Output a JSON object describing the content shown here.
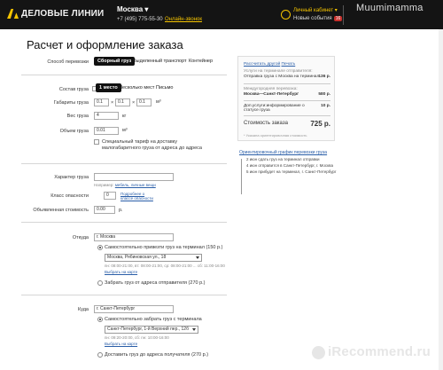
{
  "header": {
    "logo_text": "ДЕЛОВЫЕ ЛИНИИ",
    "city": "Москва ▾",
    "phone": "+7 (495) 775-55-30",
    "callback": "Онлайн-звонок",
    "cabinet": "Личный кабинет ▾",
    "events": "Новые события",
    "events_count": "16",
    "watermark": "Muumimamma"
  },
  "page": {
    "title": "Расчет и оформление заказа"
  },
  "transport": {
    "label": "Способ перевозки",
    "tabs": [
      "Сборный груз",
      "Выделенный транспорт",
      "Контейнер"
    ],
    "active": "Сборный груз"
  },
  "cargo": {
    "label": "Состав груза",
    "options": [
      "1 место",
      "Несколько мест",
      "Письмо"
    ],
    "dims_label": "Габариты груза",
    "dims": [
      "0.1",
      "0.1",
      "0.1"
    ],
    "dims_unit": "м³",
    "weight_label": "Вес груза",
    "weight": "4",
    "weight_unit": "кг",
    "volume_label": "Объем груза",
    "volume": "0.01",
    "volume_unit": "м³",
    "tariff_text": "Специальный тариф на доставку малогабаритного груза от адреса до адреса"
  },
  "nature": {
    "label": "Характер груза",
    "example_prefix": "Например:",
    "example_links": "мебель, личные вещи",
    "hazard_label": "Класс опасности",
    "hazard_value": "0",
    "hazard_link": "Подробнее о классе опасности",
    "declared_label": "Объявленная стоимость",
    "declared_value": "0.00",
    "declared_unit": "р."
  },
  "from": {
    "label": "Откуда",
    "city": "г. Москва",
    "opt1": "Самостоятельно привезти груз на терминал (150 р.)",
    "terminal": "Москва, Рябиновская ул., 18",
    "hours": "пн: 08:00-21:00, вт: 08:00-21:00, ср: 08:00-21:00 ... сб: 11:00-16:00",
    "map_link": "Выбрать на карте",
    "opt2": "Забрать груз от адреса отправителя (270 р.)"
  },
  "to": {
    "label": "Куда",
    "city": "г. Санкт-Петербург",
    "opt1": "Самостоятельно забрать груз с терминала",
    "terminal": "Санкт-Петербург, 1-й Верхний пер., 12б",
    "hours": "пн: 09:20-20:00, сб: пн: 10:00-16:00",
    "map_link": "Выбрать на карте",
    "opt2": "Доставить груз до адреса получателя (270 р.)"
  },
  "calc": {
    "link": "Рассчитать другой",
    "link2": "Печать",
    "rows": [
      {
        "text": "Услуги на терминале отправителя:",
        "val": ""
      },
      {
        "text": "Отправка груза с Москва на терминал",
        "val": "136 р."
      },
      {
        "text": "Междугородняя перевозка:",
        "val": ""
      },
      {
        "text": "Москва—Санкт-Петербург",
        "val": "580 р."
      },
      {
        "text": "Доп.услуги:информирование о статусе груза",
        "val": "10 р."
      }
    ],
    "total_label": "Стоимость заказа",
    "total_value": "725 р.",
    "note": "* Указана ориентировочная стоимость"
  },
  "schedule": {
    "title": "Ориентировочный график перевозки груза",
    "rows": [
      "2 июн сдать груз на терминал отправки",
      "4 июн отправится в Санкт-Петербург, г. Москва",
      "5 июн прибудет на терминал, г. Санкт-Петербург"
    ]
  },
  "footer_watermark": "iRecommend.ru"
}
